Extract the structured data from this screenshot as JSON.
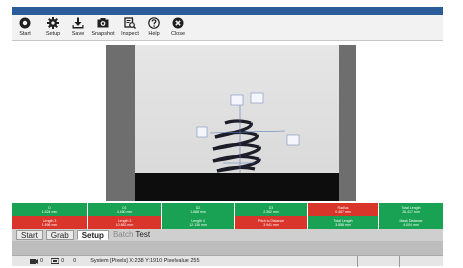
{
  "toolbar": {
    "items": [
      {
        "label": "Start",
        "icon": "start-icon"
      },
      {
        "label": "Setup",
        "icon": "gear-icon"
      },
      {
        "label": "Save",
        "icon": "download-icon"
      },
      {
        "label": "Snapshot",
        "icon": "camera-icon"
      },
      {
        "label": "Inspect",
        "icon": "inspect-icon"
      },
      {
        "label": "Help",
        "icon": "help-icon"
      },
      {
        "label": "Close",
        "icon": "close-icon"
      }
    ]
  },
  "measurements": {
    "row1": [
      {
        "name": "D",
        "value": "1.624 mm",
        "status": "green"
      },
      {
        "name": "D1",
        "value": "4.450 mm",
        "status": "green"
      },
      {
        "name": "D2",
        "value": "1.668 mm",
        "status": "green"
      },
      {
        "name": "D3",
        "value": "2.362 mm",
        "status": "green"
      },
      {
        "name": "Radius",
        "value": "0.467 mm",
        "status": "red"
      },
      {
        "name": "Total Length",
        "value": "26.417 mm",
        "status": "green"
      }
    ],
    "row2": [
      {
        "name": "Length 3",
        "value": "1.696 mm",
        "status": "red"
      },
      {
        "name": "Length 3",
        "value": "10.682 mm",
        "status": "red"
      },
      {
        "name": "Length 4",
        "value": "12.136 mm",
        "status": "green"
      },
      {
        "name": "Pitch to Distance",
        "value": "3.941 mm",
        "status": "red"
      },
      {
        "name": "Total Length",
        "value": "3.858 mm",
        "status": "green"
      },
      {
        "name": "Mask Distance",
        "value": "4.004 mm",
        "status": "green"
      }
    ]
  },
  "tabs": [
    {
      "label": "Start",
      "state": "normal"
    },
    {
      "label": "Grab",
      "state": "normal"
    },
    {
      "label": "Setup",
      "state": "active"
    },
    {
      "label": "Batch",
      "state": "dim"
    },
    {
      "label": "Test",
      "state": "flat"
    }
  ],
  "status": {
    "camera_count": "0",
    "device_count": "0",
    "unit_count": "0",
    "message": "System  [Pixels]  X:238  Y:1910  Pixelvalue 255"
  },
  "colors": {
    "green": "#1aa254",
    "red": "#d9352b",
    "title_bar": "#2a5c9a"
  }
}
